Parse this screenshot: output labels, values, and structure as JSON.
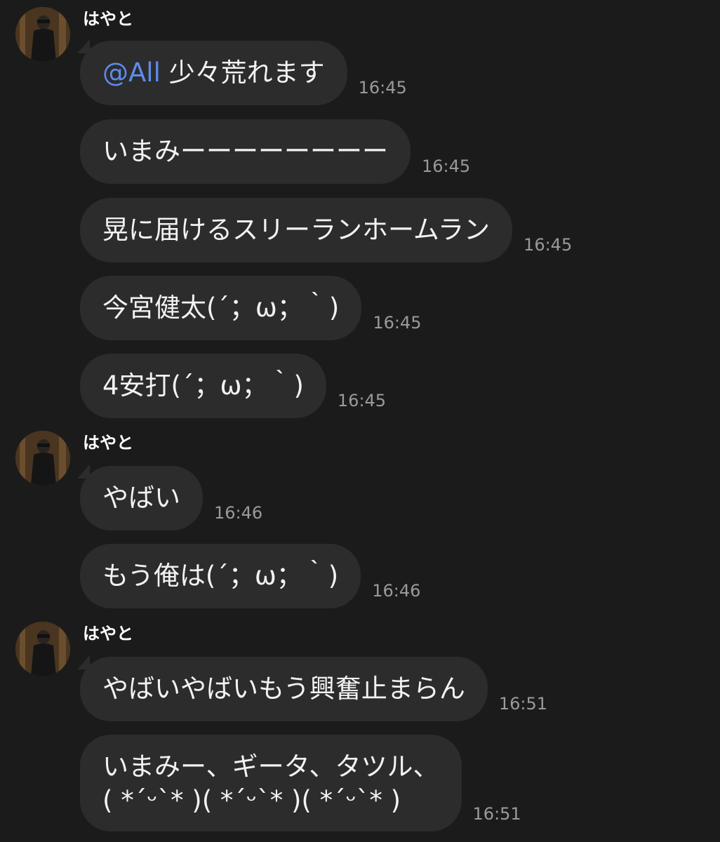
{
  "colors": {
    "background": "#1b1b1b",
    "bubble": "#2c2c2c",
    "mention": "#5d8bea",
    "timestamp": "#9a9a9a"
  },
  "groups": [
    {
      "sender": "はやと",
      "messages": [
        {
          "mention": "@All",
          "text": " 少々荒れます",
          "time": "16:45"
        },
        {
          "text": "いまみーーーーーーーー",
          "time": "16:45"
        },
        {
          "text": "晃に届けるスリーランホームラン",
          "time": "16:45"
        },
        {
          "text": "今宮健太(´；ω；｀)",
          "time": "16:45"
        },
        {
          "text": "4安打(´；ω；｀)",
          "time": "16:45"
        }
      ]
    },
    {
      "sender": "はやと",
      "messages": [
        {
          "text": "やばい",
          "time": "16:46"
        },
        {
          "text": "もう俺は(´；ω；｀)",
          "time": "16:46"
        }
      ]
    },
    {
      "sender": "はやと",
      "messages": [
        {
          "text": "やばいやばいもう興奮止まらん",
          "time": "16:51"
        },
        {
          "text": "いまみー、ギータ、タツル、\n( *´ᵕ`* )( *´ᵕ`* )( *´ᵕ`* )",
          "time": "16:51"
        }
      ]
    }
  ]
}
